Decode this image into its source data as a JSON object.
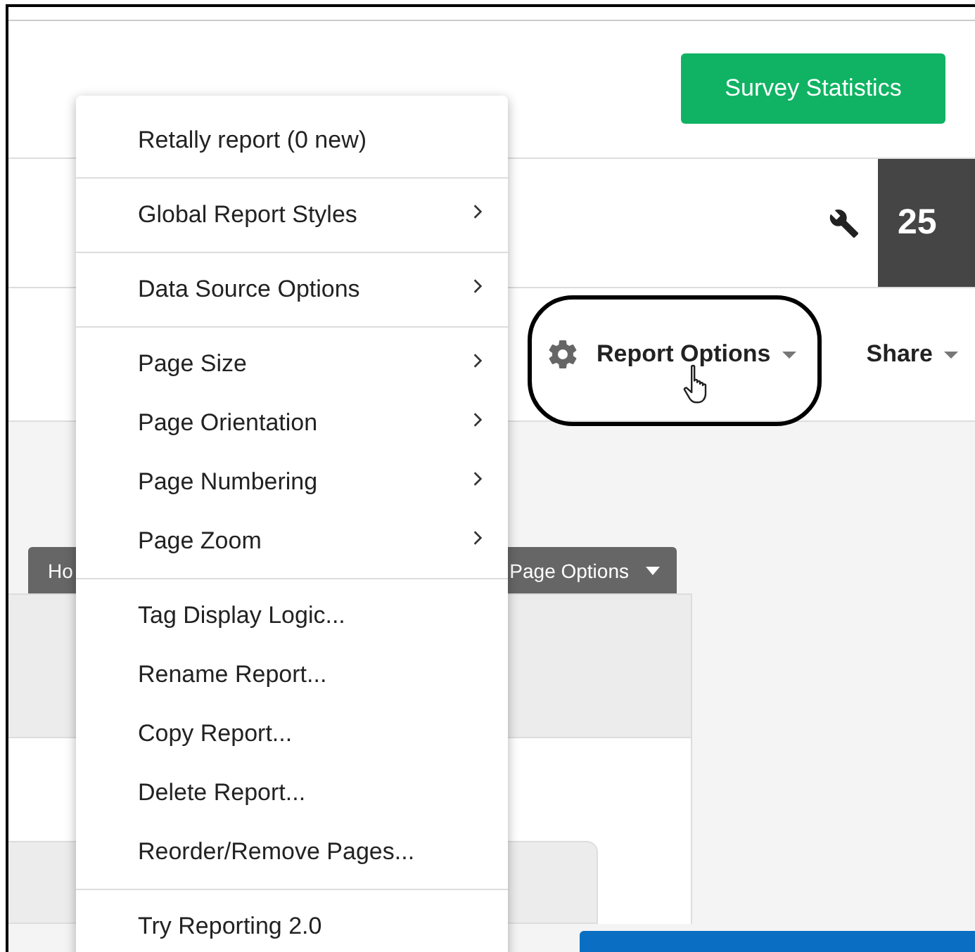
{
  "header": {
    "stats_button": "Survey Statistics"
  },
  "counter": {
    "value": "25"
  },
  "actions": [
    {
      "label": "Report Options",
      "kind": "gear",
      "circled": true
    },
    {
      "label": "Share",
      "kind": "plain",
      "circled": false
    }
  ],
  "page_tabs": [
    {
      "label": "Ho",
      "dropdown": false
    },
    {
      "label": "Page Options",
      "dropdown": true
    }
  ],
  "menu": {
    "groups": [
      [
        {
          "label": "Retally report (0 new)",
          "submenu": false
        }
      ],
      [
        {
          "label": "Global Report Styles",
          "submenu": true
        }
      ],
      [
        {
          "label": "Data Source Options",
          "submenu": true
        }
      ],
      [
        {
          "label": "Page Size",
          "submenu": true
        },
        {
          "label": "Page Orientation",
          "submenu": true
        },
        {
          "label": "Page Numbering",
          "submenu": true
        },
        {
          "label": "Page Zoom",
          "submenu": true
        }
      ],
      [
        {
          "label": "Tag Display Logic...",
          "submenu": false
        },
        {
          "label": "Rename Report...",
          "submenu": false
        },
        {
          "label": "Copy Report...",
          "submenu": false
        },
        {
          "label": "Delete Report...",
          "submenu": false
        },
        {
          "label": "Reorder/Remove Pages...",
          "submenu": false
        }
      ],
      [
        {
          "label": "Try Reporting 2.0",
          "submenu": false
        }
      ]
    ]
  }
}
